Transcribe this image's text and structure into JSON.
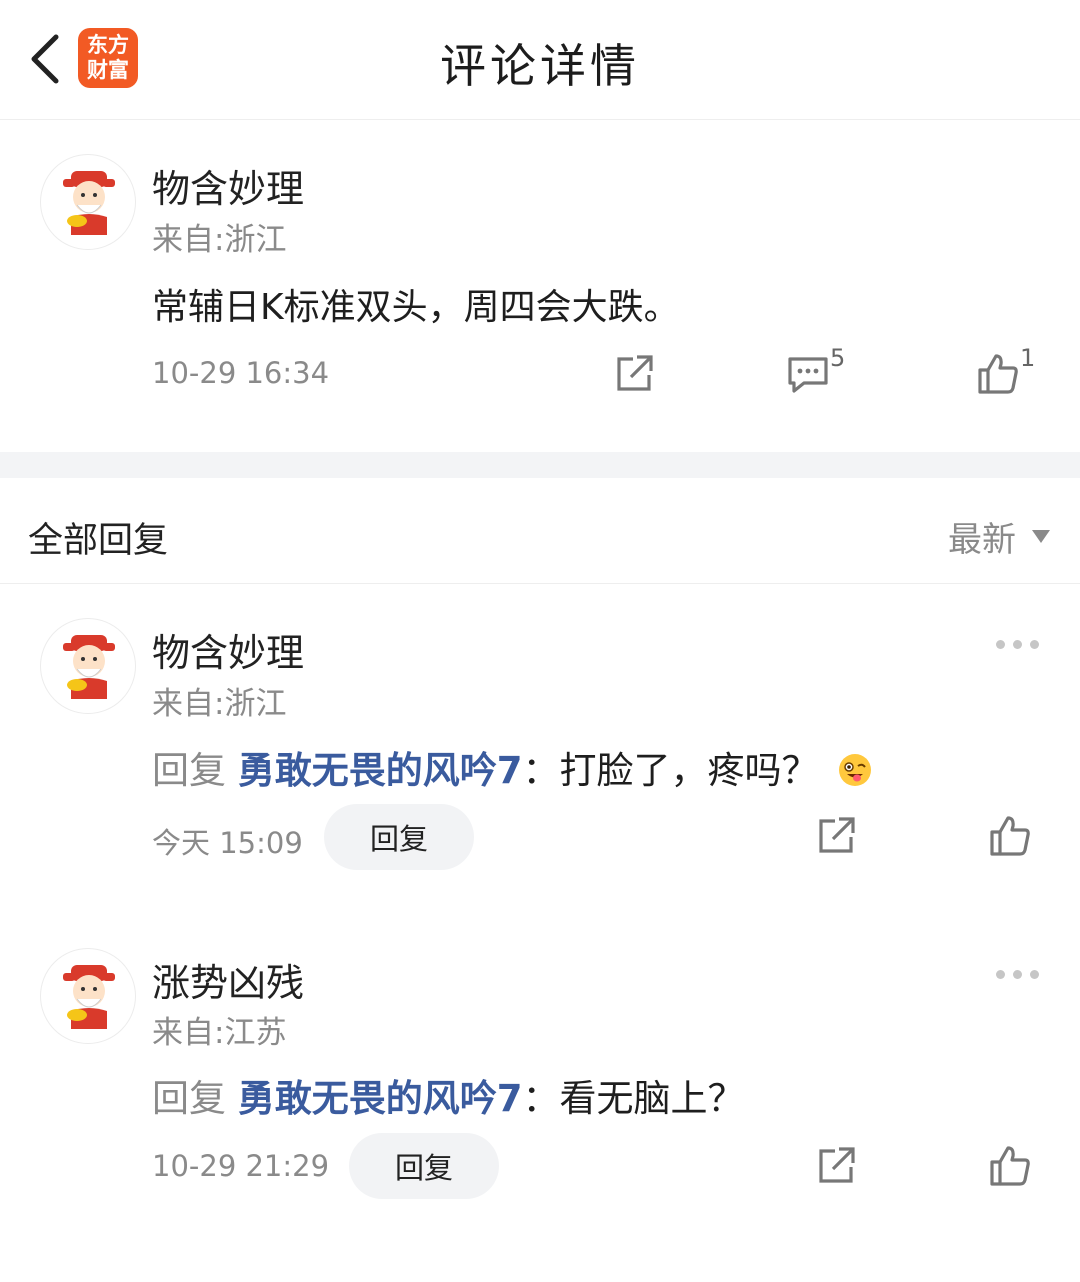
{
  "header": {
    "title": "评论详情",
    "logo_line1": "东方",
    "logo_line2": "财富",
    "brand_color": "#f25a24"
  },
  "main_comment": {
    "author": "物含妙理",
    "location": "来自:浙江",
    "text": "常辅日K标准双头，周四会大跌。",
    "time": "10-29 16:34",
    "comment_count": "5",
    "like_count": "1"
  },
  "replies_section": {
    "title": "全部回复",
    "sort_label": "最新"
  },
  "replies": [
    {
      "author": "物含妙理",
      "location": "来自:浙江",
      "reply_prefix": "回复",
      "reply_target": "勇敢无畏的风吟7",
      "text": "：打脸了，疼吗？",
      "time": "今天 15:09",
      "reply_button": "回复",
      "emoji": "wink-tongue-emoji"
    },
    {
      "author": "涨势凶残",
      "location": "来自:江苏",
      "reply_prefix": "回复",
      "reply_target": "勇敢无畏的风吟7",
      "text": "：看无脑上？",
      "time": "10-29 21:29",
      "reply_button": "回复"
    }
  ],
  "colors": {
    "link_blue": "#3a5b9e",
    "secondary_text": "#8a8a8a"
  }
}
